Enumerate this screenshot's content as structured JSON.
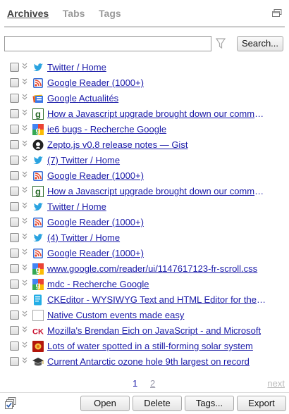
{
  "tabs": [
    {
      "label": "Archives",
      "active": true
    },
    {
      "label": "Tabs",
      "active": false
    },
    {
      "label": "Tags",
      "active": false
    }
  ],
  "search": {
    "value": "",
    "placeholder": "",
    "button_label": "Search..."
  },
  "items": [
    {
      "title": "Twitter / Home",
      "icon": "twitter-icon"
    },
    {
      "title": "Google Reader (1000+)",
      "icon": "google-reader-icon"
    },
    {
      "title": "Google Actualités",
      "icon": "google-news-icon"
    },
    {
      "title": "How a Javascript upgrade brought down our comments",
      "icon": "g-letter-icon"
    },
    {
      "title": "ie6 bugs - Recherche Google",
      "icon": "google-search-icon"
    },
    {
      "title": "Zepto.js v0.8 release notes — Gist",
      "icon": "github-icon"
    },
    {
      "title": "(7) Twitter / Home",
      "icon": "twitter-icon"
    },
    {
      "title": "Google Reader (1000+)",
      "icon": "google-reader-icon"
    },
    {
      "title": "How a Javascript upgrade brought down our comments",
      "icon": "g-letter-icon"
    },
    {
      "title": "Twitter / Home",
      "icon": "twitter-icon"
    },
    {
      "title": "Google Reader (1000+)",
      "icon": "google-reader-icon"
    },
    {
      "title": "(4) Twitter / Home",
      "icon": "twitter-icon"
    },
    {
      "title": "Google Reader (1000+)",
      "icon": "google-reader-icon"
    },
    {
      "title": "www.google.com/reader/ui/1147617123-fr-scroll.css",
      "icon": "google-search-icon"
    },
    {
      "title": "mdc - Recherche Google",
      "icon": "google-search-icon"
    },
    {
      "title": "CKEditor - WYSIWYG Text and HTML Editor for the Web",
      "icon": "ckeditor-icon"
    },
    {
      "title": "Native Custom events made easy",
      "icon": "blank-page-icon"
    },
    {
      "title": "Mozilla's Brendan Eich on JavaScript - and Microsoft",
      "icon": "cnet-icon"
    },
    {
      "title": "Lots of water spotted in a still-forming solar system",
      "icon": "science-icon"
    },
    {
      "title": "Current Antarctic ozone hole 9th largest on record",
      "icon": "graduation-cap-icon"
    }
  ],
  "pager": {
    "pages": [
      "1",
      "2"
    ],
    "next_label": "next"
  },
  "footer": {
    "open": "Open",
    "delete": "Delete",
    "tags": "Tags...",
    "export": "Export"
  }
}
